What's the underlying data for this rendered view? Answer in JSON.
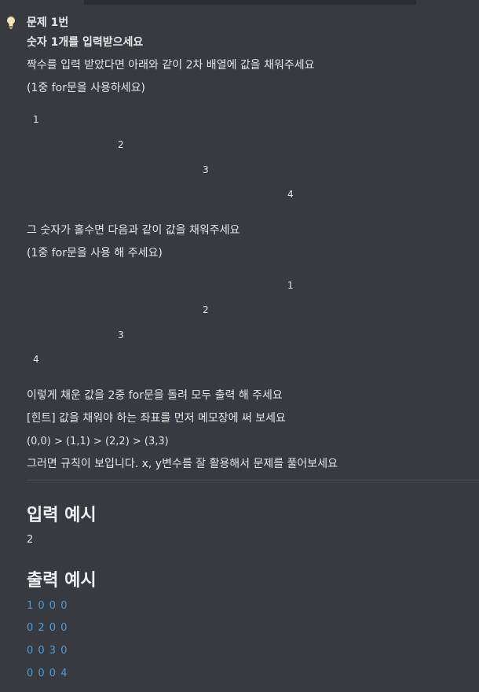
{
  "problem": {
    "title": "문제 1번",
    "subtitle": "숫자 1개를 입력받으세요",
    "even_desc": "짝수를 입력 받았다면 아래와 같이 2차 배열에 값을 채워주세요",
    "even_note": "(1중 for문을 사용하세요)",
    "even_diagram": [
      "1",
      "2",
      "3",
      "4"
    ],
    "odd_desc": "그 숫자가 홀수면 다음과 같이 값을 채워주세요",
    "odd_note": "(1중 for문을 사용 해 주세요)",
    "odd_diagram": [
      "1",
      "2",
      "3",
      "4"
    ],
    "print_desc": "이렇게 채운 값을 2중 for문을 돌려 모두 출력 해 주세요",
    "hint": "[힌트] 값을 채워야 하는 좌표를 먼저 메모장에 써 보세요",
    "coords": "(0,0) > (1,1) > (2,2) > (3,3)",
    "hint_tail": "그러면 규칙이 보입니다. x, y변수를 잘 활용해서 문제를 풀어보세요"
  },
  "input_example": {
    "heading": "입력 예시",
    "value": "2"
  },
  "output_example": {
    "heading": "출력 예시",
    "lines": [
      "1 0 0 0",
      "0 2 0 0",
      "0 0 3 0",
      "0 0 0 4"
    ]
  },
  "colors": {
    "background": "#373b40",
    "output_text": "#4f9ad8",
    "bulb": "#f3e6b0"
  }
}
